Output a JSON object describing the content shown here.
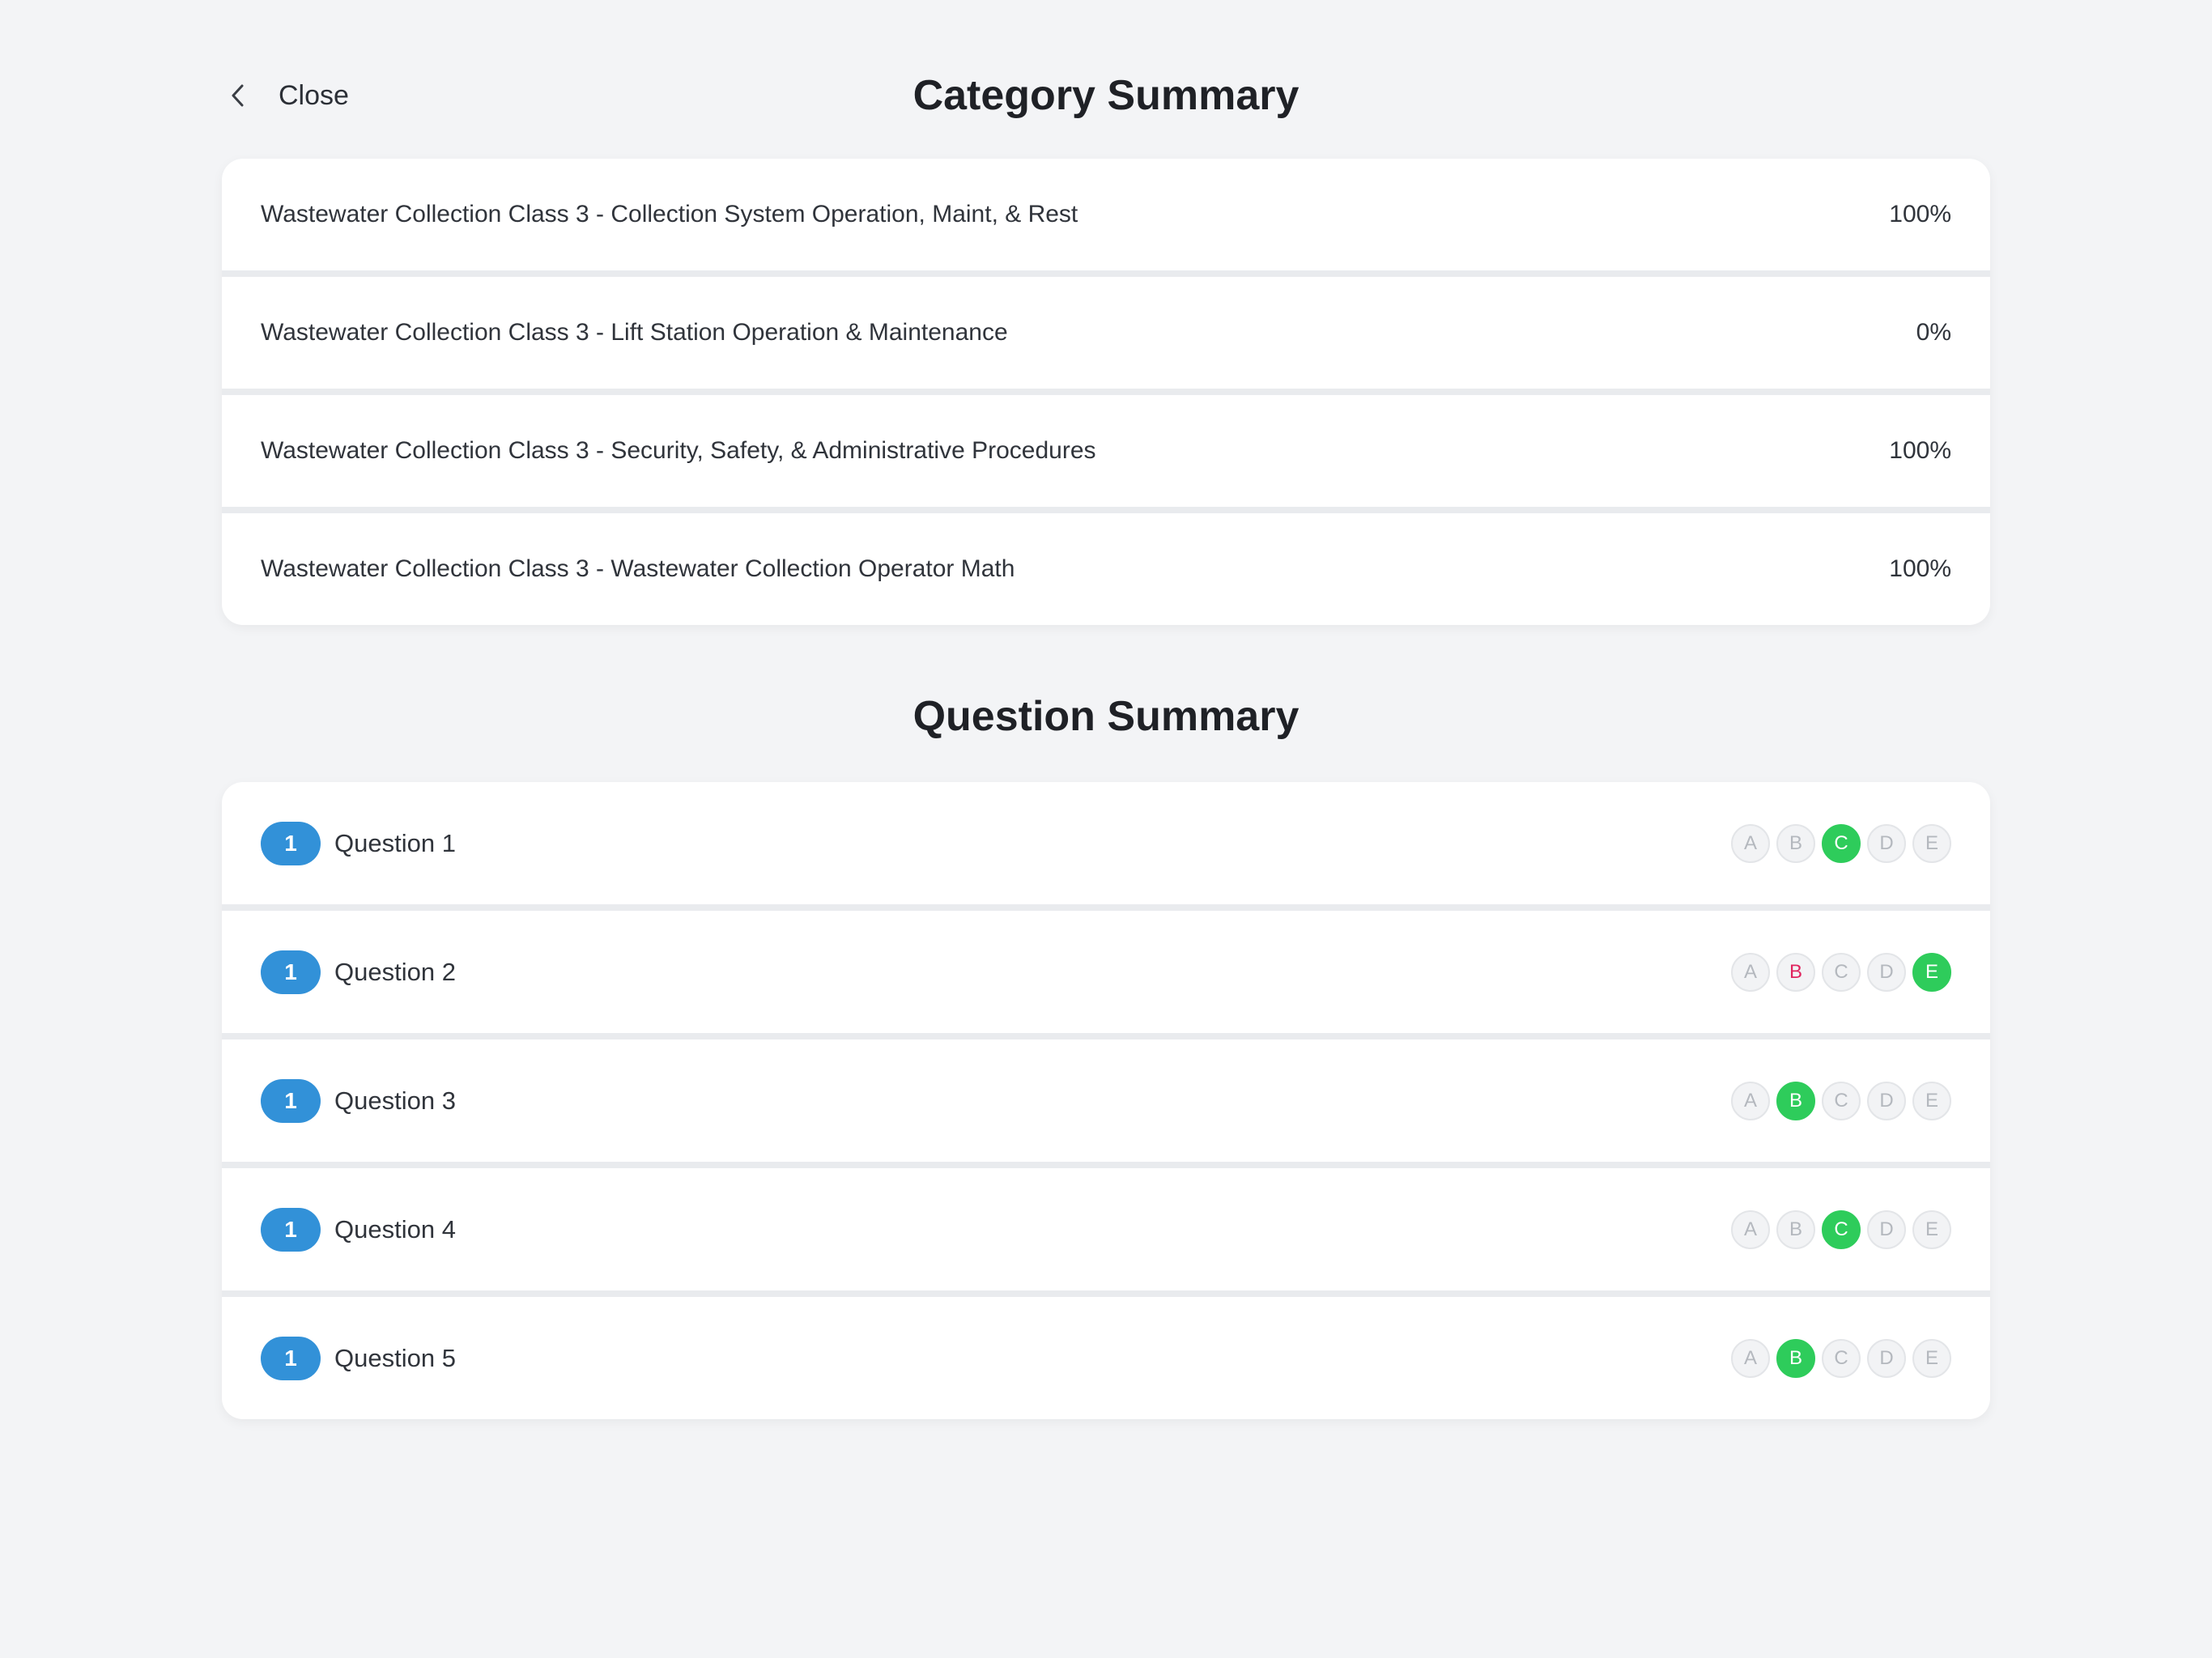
{
  "header": {
    "close_label": "Close",
    "title": "Category Summary"
  },
  "categories": [
    {
      "name": "Wastewater Collection Class 3 - Collection System Operation, Maint, & Rest",
      "percent": "100%"
    },
    {
      "name": "Wastewater Collection Class 3 - Lift Station Operation & Maintenance",
      "percent": "0%"
    },
    {
      "name": "Wastewater Collection Class 3 - Security, Safety, & Administrative Procedures",
      "percent": "100%"
    },
    {
      "name": "Wastewater Collection Class 3 - Wastewater Collection Operator Math",
      "percent": "100%"
    }
  ],
  "question_summary": {
    "title": "Question Summary",
    "questions": [
      {
        "badge": "1",
        "label": "Question 1",
        "options": [
          {
            "letter": "A",
            "state": "neutral"
          },
          {
            "letter": "B",
            "state": "neutral"
          },
          {
            "letter": "C",
            "state": "correct"
          },
          {
            "letter": "D",
            "state": "neutral"
          },
          {
            "letter": "E",
            "state": "neutral"
          }
        ]
      },
      {
        "badge": "1",
        "label": "Question 2",
        "options": [
          {
            "letter": "A",
            "state": "neutral"
          },
          {
            "letter": "B",
            "state": "wrong"
          },
          {
            "letter": "C",
            "state": "neutral"
          },
          {
            "letter": "D",
            "state": "neutral"
          },
          {
            "letter": "E",
            "state": "correct"
          }
        ]
      },
      {
        "badge": "1",
        "label": "Question 3",
        "options": [
          {
            "letter": "A",
            "state": "neutral"
          },
          {
            "letter": "B",
            "state": "correct"
          },
          {
            "letter": "C",
            "state": "neutral"
          },
          {
            "letter": "D",
            "state": "neutral"
          },
          {
            "letter": "E",
            "state": "neutral"
          }
        ]
      },
      {
        "badge": "1",
        "label": "Question 4",
        "options": [
          {
            "letter": "A",
            "state": "neutral"
          },
          {
            "letter": "B",
            "state": "neutral"
          },
          {
            "letter": "C",
            "state": "correct"
          },
          {
            "letter": "D",
            "state": "neutral"
          },
          {
            "letter": "E",
            "state": "neutral"
          }
        ]
      },
      {
        "badge": "1",
        "label": "Question 5",
        "options": [
          {
            "letter": "A",
            "state": "neutral"
          },
          {
            "letter": "B",
            "state": "correct"
          },
          {
            "letter": "C",
            "state": "neutral"
          },
          {
            "letter": "D",
            "state": "neutral"
          },
          {
            "letter": "E",
            "state": "neutral"
          }
        ]
      }
    ]
  },
  "colors": {
    "background": "#f3f4f6",
    "badge_blue": "#3291d8",
    "correct_green": "#2ecc5b",
    "wrong_red": "#e0245e"
  },
  "icons": {
    "close": "chevron-left-icon"
  }
}
